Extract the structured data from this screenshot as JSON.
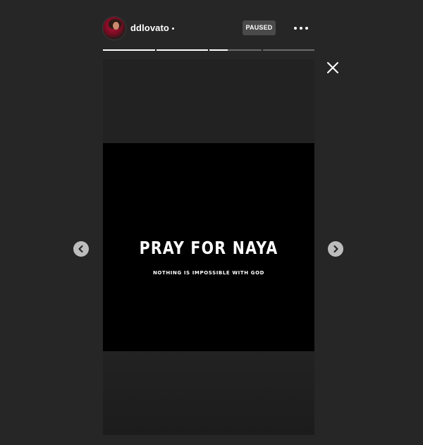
{
  "header": {
    "username": "ddlovato",
    "status_badge": "PAUSED",
    "avatar_icon": "user-avatar",
    "more_icon": "more-horizontal-icon"
  },
  "progress": {
    "segments": [
      1,
      1,
      0.35,
      0
    ]
  },
  "story": {
    "headline": "PRAY FOR NAYA",
    "subline": "NOTHING IS IMPOSSIBLE WITH GOD"
  },
  "controls": {
    "close_icon": "close-icon",
    "prev_icon": "chevron-left-icon",
    "next_icon": "chevron-right-icon"
  },
  "colors": {
    "background": "#262626",
    "story_black": "#000000",
    "badge": "#4a4a4a",
    "progress_track": "#6b6b6b",
    "progress_fill": "#ffffff"
  }
}
